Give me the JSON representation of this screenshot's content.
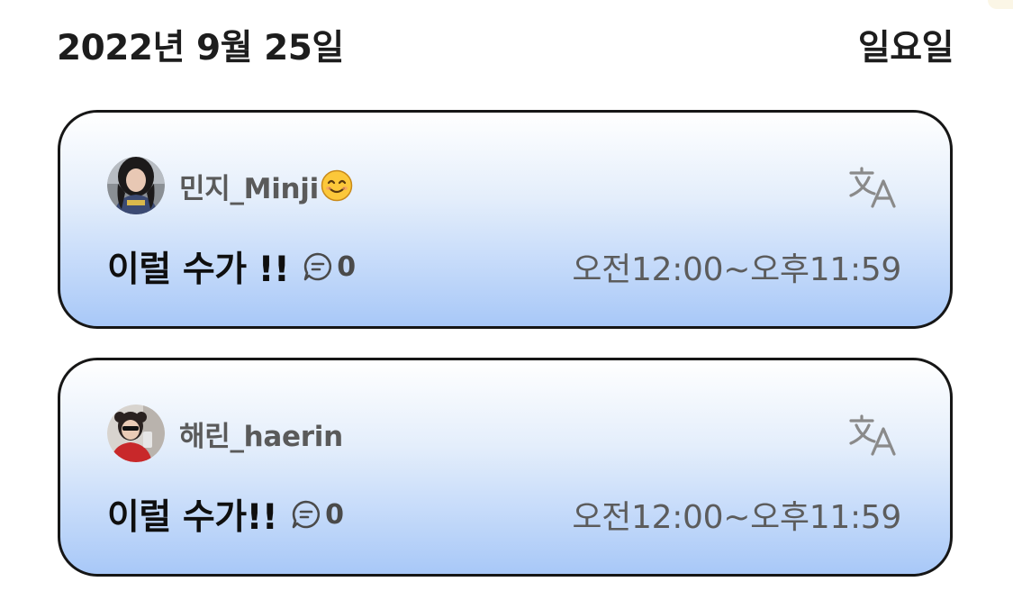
{
  "header": {
    "date": "2022년 9월 25일",
    "weekday": "일요일"
  },
  "posts": [
    {
      "username": "민지_Minji",
      "has_emoji": true,
      "emoji_icon": "smiling-face-icon",
      "title": "이럴 수가 !!",
      "comment_count": "0",
      "time_range": "오전12:00~오후11:59",
      "translate_icon": "translate-icon",
      "comment_icon": "comment-bubble-icon"
    },
    {
      "username": "해린_haerin",
      "has_emoji": false,
      "title": "이럴 수가!!",
      "comment_count": "0",
      "time_range": "오전12:00~오후11:59",
      "translate_icon": "translate-icon",
      "comment_icon": "comment-bubble-icon"
    }
  ],
  "colors": {
    "card_gradient_top": "#ffffff",
    "card_gradient_bottom": "#a8c8f8",
    "card_border": "#161616",
    "muted_text": "#5c5c5c"
  }
}
